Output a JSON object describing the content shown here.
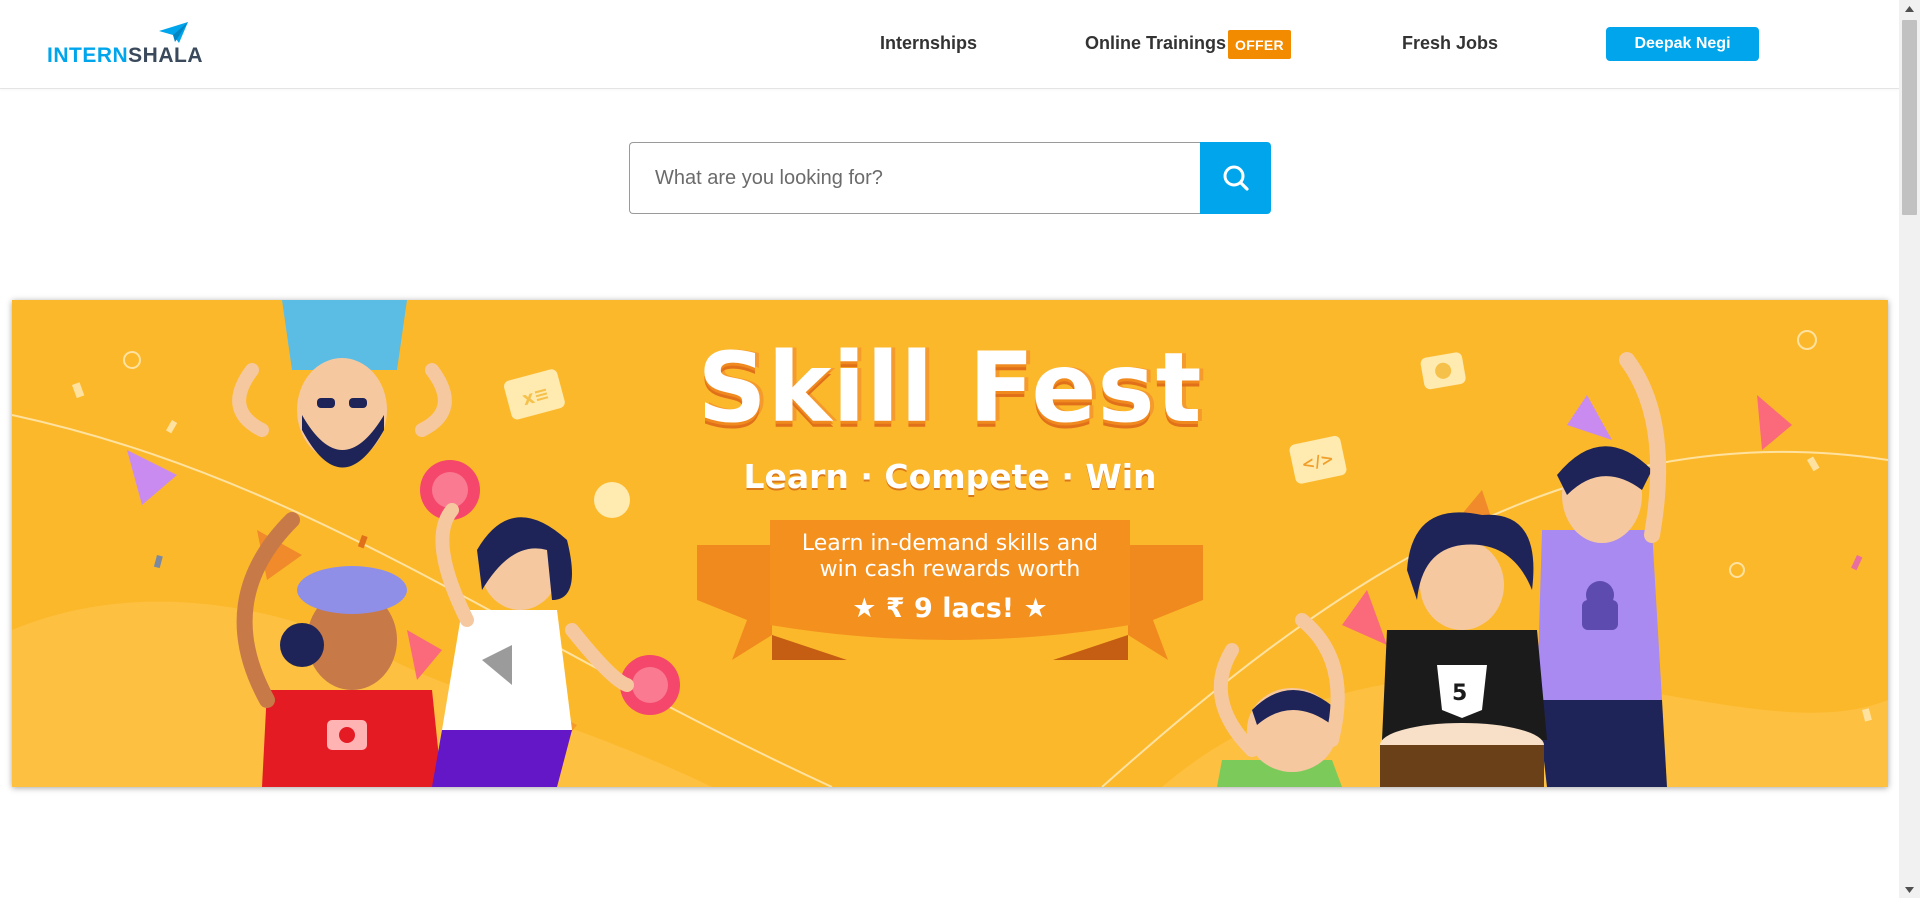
{
  "brand": {
    "part1": "INTERN",
    "part2": "SHALA"
  },
  "nav": {
    "internships": "Internships",
    "trainings": "Online Trainings",
    "offer_badge": "OFFER",
    "jobs": "Fresh Jobs",
    "user": "Deepak Negi"
  },
  "search": {
    "placeholder": "What are you looking for?"
  },
  "banner": {
    "title": "Skill Fest",
    "subtitle": "Learn · Compete · Win",
    "ribbon_line1": "Learn in-demand skills and",
    "ribbon_line2": "win cash rewards worth",
    "ribbon_amount": "★  ₹ 9 lacs!  ★"
  },
  "colors": {
    "brand_blue": "#00a5ec",
    "offer_orange": "#f28b00",
    "banner_yellow": "#fcb82b",
    "ribbon_orange": "#f4911e"
  },
  "icons": [
    "paper-plane-icon",
    "search-icon",
    "scroll-up-arrow-icon",
    "scroll-down-arrow-icon"
  ]
}
